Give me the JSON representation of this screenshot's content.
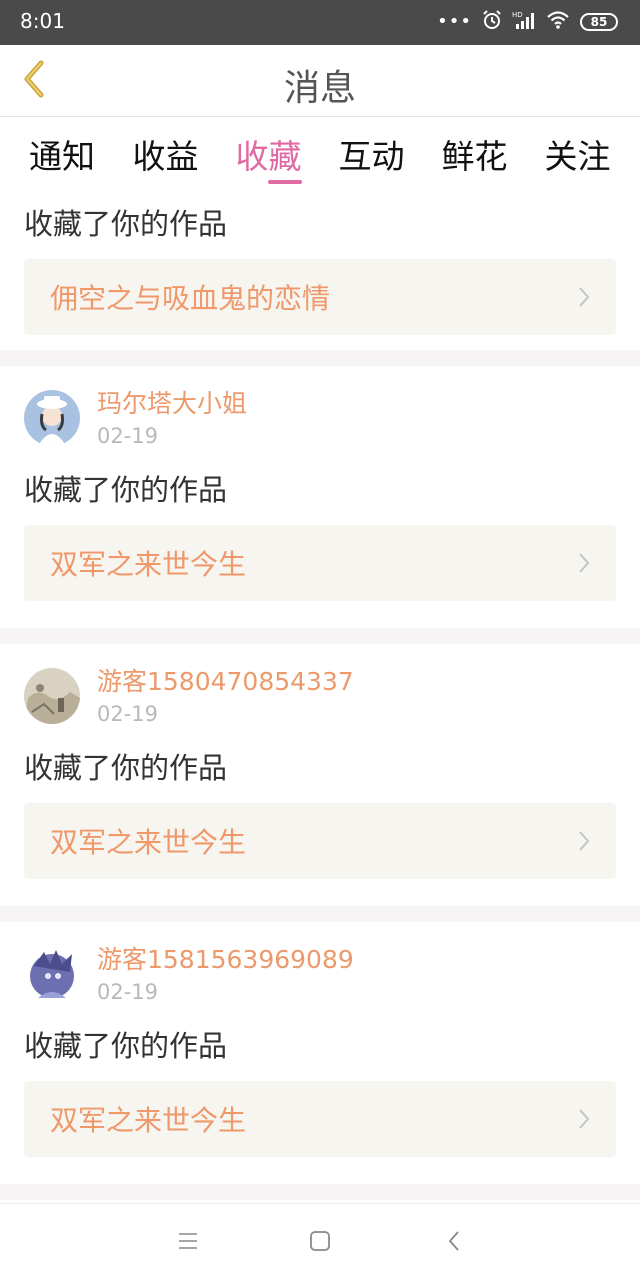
{
  "status_bar": {
    "time": "8:01",
    "dots": "•••",
    "battery": "85"
  },
  "header": {
    "title": "消息"
  },
  "tabs": [
    {
      "label": "通知",
      "active": false
    },
    {
      "label": "收益",
      "active": false
    },
    {
      "label": "收藏",
      "active": true
    },
    {
      "label": "互动",
      "active": false
    },
    {
      "label": "鲜花",
      "active": false
    },
    {
      "label": "关注",
      "active": false
    }
  ],
  "feed": [
    {
      "action": "收藏了你的作品",
      "work_title": "佣空之与吸血鬼的恋情"
    },
    {
      "username": "玛尔塔大小姐",
      "date": "02-19",
      "action": "收藏了你的作品",
      "work_title": "双军之来世今生"
    },
    {
      "username": "游客1580470854337",
      "date": "02-19",
      "action": "收藏了你的作品",
      "work_title": "双军之来世今生"
    },
    {
      "username": "游客1581563969089",
      "date": "02-19",
      "action": "收藏了你的作品",
      "work_title": "双军之来世今生"
    }
  ],
  "colors": {
    "accent": "#e06aa4",
    "link": "#f0986a",
    "username": "#ec9a6b"
  }
}
